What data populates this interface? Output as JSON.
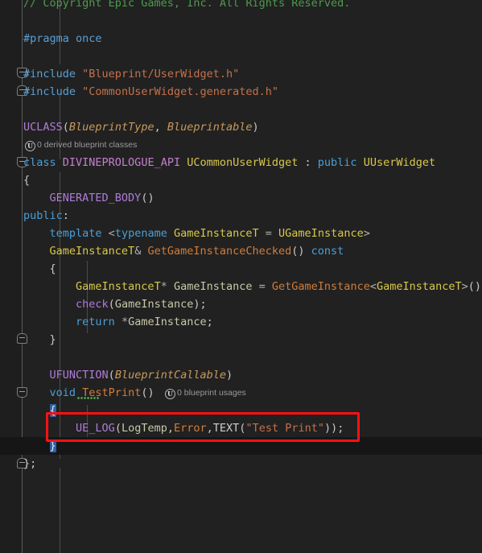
{
  "editor": {
    "language": "cpp",
    "theme_background": "#212121",
    "gutter_background": "#1d1e1d",
    "annotation_color": "#ff1111",
    "current_line_color": "#161616",
    "bracket_match_color": "#2f5fa8",
    "squiggle_color": "#5ab552"
  },
  "code_lines": [
    {
      "indent": 0,
      "text": "// Copyright Epic Games, Inc. All Rights Reserved."
    },
    {
      "indent": 0,
      "text": ""
    },
    {
      "indent": 0,
      "text": "#pragma once"
    },
    {
      "indent": 0,
      "text": ""
    },
    {
      "indent": 0,
      "text": "#include \"Blueprint/UserWidget.h\""
    },
    {
      "indent": 0,
      "text": "#include \"CommonUserWidget.generated.h\""
    },
    {
      "indent": 0,
      "text": ""
    },
    {
      "indent": 0,
      "text": "UCLASS(BlueprintType, Blueprintable)"
    },
    {
      "indent": 0,
      "text": "class DIVINEPROLOGUE_API UCommonUserWidget : public UUserWidget"
    },
    {
      "indent": 0,
      "text": "{"
    },
    {
      "indent": 1,
      "text": "GENERATED_BODY()"
    },
    {
      "indent": 0,
      "text": "public:"
    },
    {
      "indent": 1,
      "text": "template <typename GameInstanceT = UGameInstance>"
    },
    {
      "indent": 1,
      "text": "GameInstanceT& GetGameInstanceChecked() const"
    },
    {
      "indent": 1,
      "text": "{"
    },
    {
      "indent": 2,
      "text": "GameInstanceT* GameInstance = GetGameInstance<GameInstanceT>();"
    },
    {
      "indent": 2,
      "text": "check(GameInstance);"
    },
    {
      "indent": 2,
      "text": "return *GameInstance;"
    },
    {
      "indent": 1,
      "text": "}"
    },
    {
      "indent": 0,
      "text": ""
    },
    {
      "indent": 1,
      "text": "UFUNCTION(BlueprintCallable)"
    },
    {
      "indent": 1,
      "text": "void TestPrint()"
    },
    {
      "indent": 1,
      "text": "{"
    },
    {
      "indent": 2,
      "text": "UE_LOG(LogTemp,Error,TEXT(\"Test Print\"));"
    },
    {
      "indent": 1,
      "text": "}"
    },
    {
      "indent": 0,
      "text": "};"
    }
  ],
  "tokens": {
    "comment_copyright": "// Copyright Epic Games, Inc. All Rights Reserved.",
    "pragma_once": "#pragma once",
    "include_keyword": "#include",
    "include_userwidget": "\"Blueprint/UserWidget.h\"",
    "include_generated": "\"CommonUserWidget.generated.h\"",
    "uclass_macro": "UCLASS",
    "uclass_spec_1": "BlueprintType",
    "uclass_spec_2": "Blueprintable",
    "class_keyword": "class",
    "api_macro": "DIVINEPROLOGUE_API",
    "class_name": "UCommonUserWidget",
    "public_keyword": "public",
    "base_class": "UUserWidget",
    "generated_body": "GENERATED_BODY",
    "public_label": "public:",
    "template_keyword": "template",
    "typename_keyword": "typename",
    "template_param": "GameInstanceT",
    "template_default": "UGameInstance",
    "return_type": "GameInstanceT",
    "method_name": "GetGameInstanceChecked",
    "const_keyword": "const",
    "local_var": "GameInstance",
    "get_game_instance": "GetGameInstance",
    "check_macro": "check",
    "return_keyword": "return",
    "ufunction_macro": "UFUNCTION",
    "ufunction_spec": "BlueprintCallable",
    "void_keyword": "void",
    "test_print_name": "TestPrint",
    "ue_log_macro": "UE_LOG",
    "log_category": "LogTemp",
    "log_verbosity": "Error",
    "text_macro": "TEXT",
    "log_string": "\"Test Print\""
  },
  "code_lens": [
    {
      "icon": "unreal-u-icon",
      "badge": "U",
      "label": "0 derived blueprint classes"
    },
    {
      "icon": "unreal-u-icon",
      "badge": "U",
      "label": "0 blueprint usages"
    }
  ]
}
